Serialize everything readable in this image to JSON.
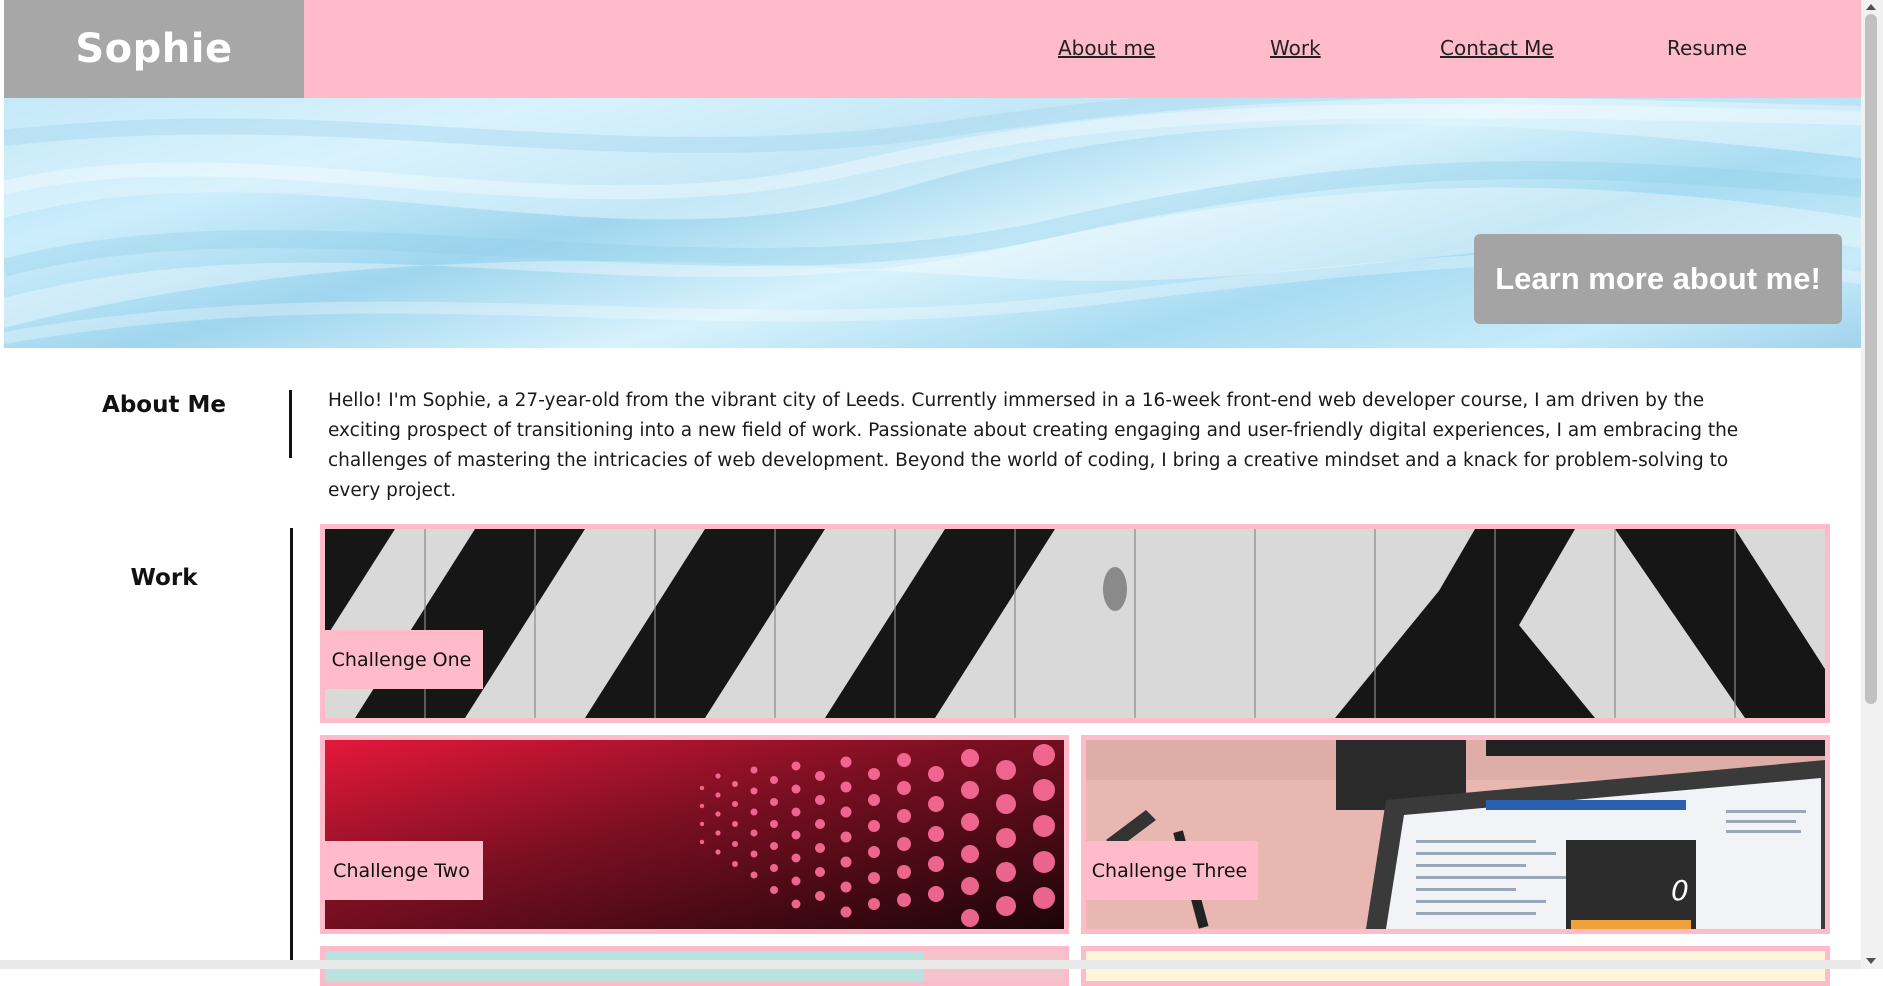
{
  "header": {
    "logo": "Sophie",
    "nav": [
      {
        "label": "About me"
      },
      {
        "label": "Work"
      },
      {
        "label": "Contact Me"
      },
      {
        "label": "Resume"
      }
    ]
  },
  "hero": {
    "button_label": "Learn more about me!"
  },
  "about": {
    "heading": "About Me",
    "text": "Hello! I'm Sophie, a 27-year-old from the vibrant city of Leeds. Currently immersed in a 16-week front-end web developer course, I am driven by the exciting prospect of transitioning into a new field of work. Passionate about creating engaging and user-friendly digital experiences, I am embracing the challenges of mastering the intricacies of web development. Beyond the world of coding, I bring a creative mindset and a knack for problem-solving to every project."
  },
  "work": {
    "heading": "Work",
    "challenges": [
      {
        "label": "Challenge One"
      },
      {
        "label": "Challenge Two"
      },
      {
        "label": "Challenge Three"
      }
    ]
  },
  "colors": {
    "header_bg": "#ffbbc9",
    "logo_bg": "#a7a7a7",
    "accent_pink": "#ffbbc9",
    "hero_button_bg": "#a4a4a4"
  }
}
